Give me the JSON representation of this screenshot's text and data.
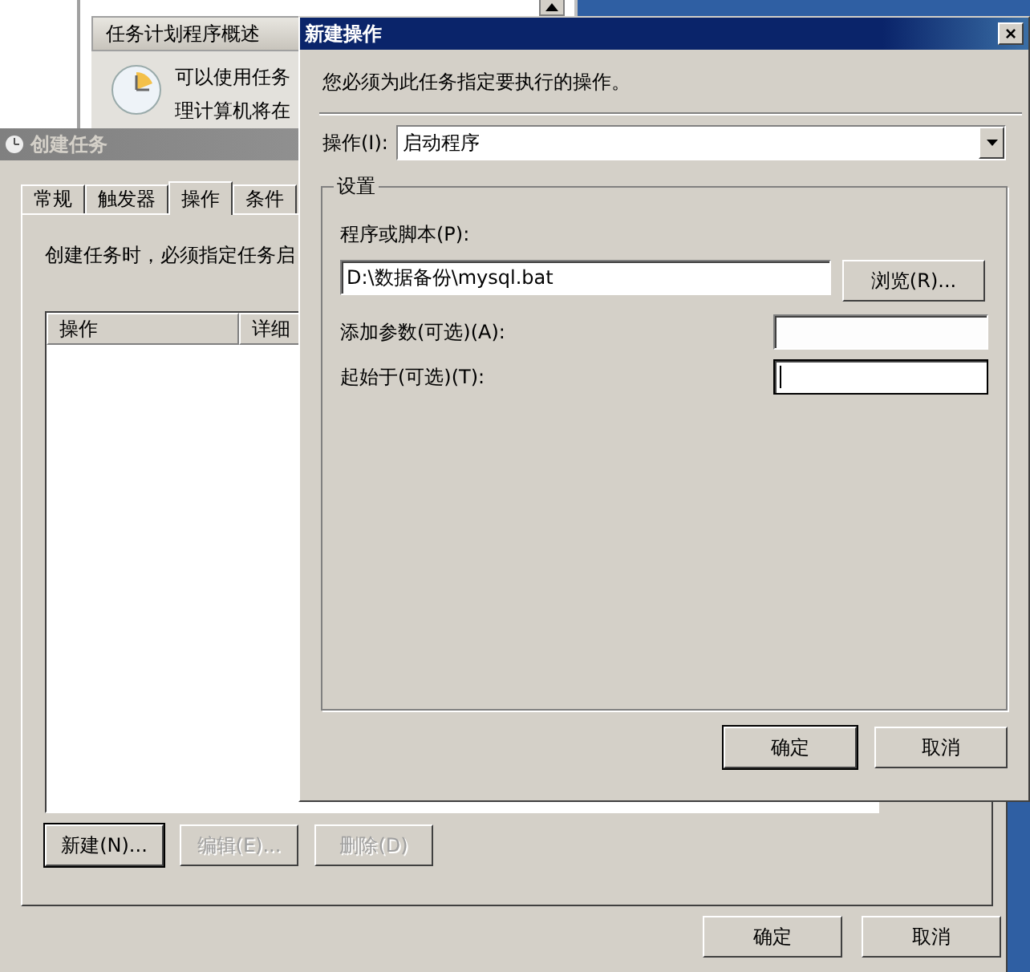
{
  "overview_window": {
    "section_title": "任务计划程序概述",
    "lines": [
      "可以使用任务",
      "理计算机将在"
    ]
  },
  "create_task": {
    "title": "创建任务",
    "active": false,
    "tabs": [
      {
        "label": "常规",
        "selected": false
      },
      {
        "label": "触发器",
        "selected": false
      },
      {
        "label": "操作",
        "selected": true
      },
      {
        "label": "条件",
        "selected": false
      }
    ],
    "description": "创建任务时，必须指定任务启",
    "list": {
      "columns": [
        "操作",
        "详细"
      ]
    },
    "buttons": [
      {
        "label": "新建(N)...",
        "disabled": false,
        "default": true
      },
      {
        "label": "编辑(E)...",
        "disabled": true,
        "default": false
      },
      {
        "label": "删除(D)",
        "disabled": true,
        "default": false
      }
    ],
    "footer_buttons": [
      {
        "label": "确定",
        "default": false
      },
      {
        "label": "取消",
        "default": false
      }
    ]
  },
  "new_action": {
    "title": "新建操作",
    "active": true,
    "close": "×",
    "instruction": "您必须为此任务指定要执行的操作。",
    "action": {
      "label": "操作(I):",
      "value": "启动程序"
    },
    "group": {
      "title": "设置",
      "program": {
        "label": "程序或脚本(P):",
        "value": "D:\\数据备份\\mysql.bat",
        "browse": "浏览(R)..."
      },
      "fields": [
        {
          "label": "添加参数(可选)(A):",
          "focused": false
        },
        {
          "label": "起始于(可选)(T):",
          "focused": true
        }
      ]
    },
    "buttons": [
      {
        "label": "确定",
        "default": true
      },
      {
        "label": "取消",
        "default": false
      }
    ]
  }
}
